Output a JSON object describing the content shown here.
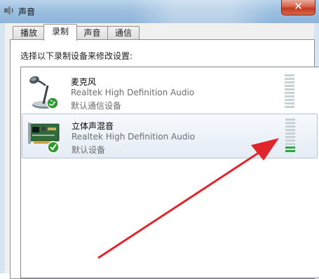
{
  "window": {
    "title": "声音",
    "close_glyph": "✕"
  },
  "tabs": [
    {
      "label": "播放",
      "active": false
    },
    {
      "label": "录制",
      "active": true
    },
    {
      "label": "声音",
      "active": false
    },
    {
      "label": "通信",
      "active": false
    }
  ],
  "instruction": "选择以下录制设备来修改设置:",
  "devices": [
    {
      "name": "麦克风",
      "driver": "Realtek High Definition Audio",
      "status": "默认通信设备",
      "icon": "microphone-icon",
      "selected": false,
      "level": 0
    },
    {
      "name": "立体声混音",
      "driver": "Realtek High Definition Audio",
      "status": "默认设备",
      "icon": "sound-card-icon",
      "selected": true,
      "level": 0.2
    }
  ],
  "colors": {
    "arrow": "#e0252c",
    "meter_lit": "#2fa33f",
    "meter_idle": "#c8d1d6"
  }
}
